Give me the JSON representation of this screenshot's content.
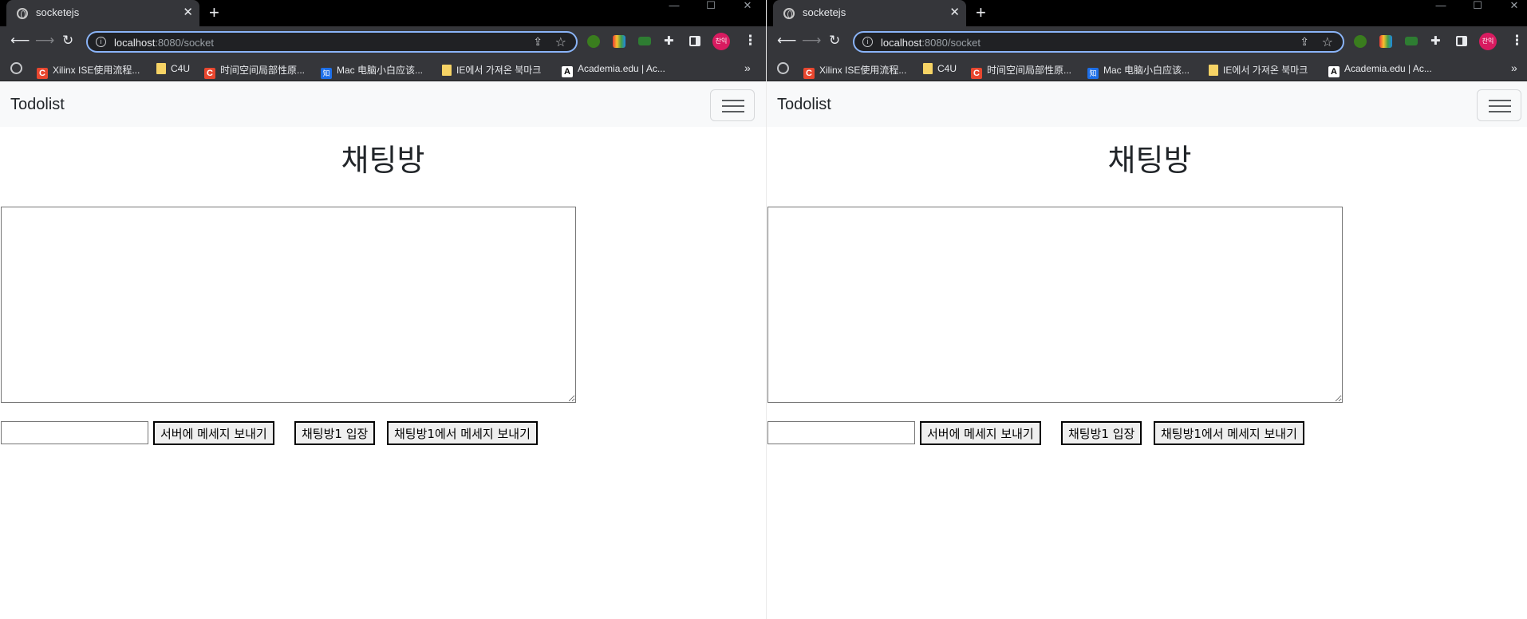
{
  "windows": [
    {
      "id": "left",
      "browser": {
        "tab_title": "socketejs",
        "tab_close": "✕",
        "new_tab": "+",
        "window_controls": {
          "minimize": "—",
          "maximize": "☐",
          "close": "✕"
        },
        "url_host": "localhost",
        "url_rest": ":8080/socket",
        "profile_initials": "찬익",
        "bookmarks": [
          {
            "icon": "c",
            "label": "Xilinx ISE使用流程..."
          },
          {
            "icon": "f",
            "label": "C4U"
          },
          {
            "icon": "c",
            "label": "时间空间局部性原..."
          },
          {
            "icon": "z",
            "label": "Mac 电脑小白应该..."
          },
          {
            "icon": "f",
            "label": "IE에서 가져온 북마크"
          },
          {
            "icon": "a",
            "label": "Academia.edu | Ac..."
          }
        ],
        "bookmarks_more": "»"
      },
      "page": {
        "brand": "Todolist",
        "heading": "채팅방",
        "textarea_value": "",
        "message_input_value": "",
        "buttons": {
          "send_server": "서버에 메세지 보내기",
          "join_room": "채팅방1 입장",
          "send_room": "채팅방1에서 메세지 보내기"
        }
      }
    },
    {
      "id": "right",
      "browser": {
        "tab_title": "socketejs",
        "tab_close": "✕",
        "new_tab": "+",
        "window_controls": {
          "minimize": "—",
          "maximize": "☐",
          "close": "✕"
        },
        "url_host": "localhost",
        "url_rest": ":8080/socket",
        "profile_initials": "찬익",
        "bookmarks": [
          {
            "icon": "c",
            "label": "Xilinx ISE使用流程..."
          },
          {
            "icon": "f",
            "label": "C4U"
          },
          {
            "icon": "c",
            "label": "时间空间局部性原..."
          },
          {
            "icon": "z",
            "label": "Mac 电脑小白应该..."
          },
          {
            "icon": "f",
            "label": "IE에서 가져온 북마크"
          },
          {
            "icon": "a",
            "label": "Academia.edu | Ac..."
          }
        ],
        "bookmarks_more": "»"
      },
      "page": {
        "brand": "Todolist",
        "heading": "채팅방",
        "textarea_value": "",
        "message_input_value": "",
        "buttons": {
          "send_server": "서버에 메세지 보내기",
          "join_room": "채팅방1 입장",
          "send_room": "채팅방1에서 메세지 보내기"
        }
      }
    }
  ],
  "colors": {
    "tabstrip": "#000000",
    "toolbar": "#35363a",
    "omnibox_border": "#8ab4f8",
    "navbar_bg": "#f8f9fa",
    "avatar": "#d81b60"
  }
}
